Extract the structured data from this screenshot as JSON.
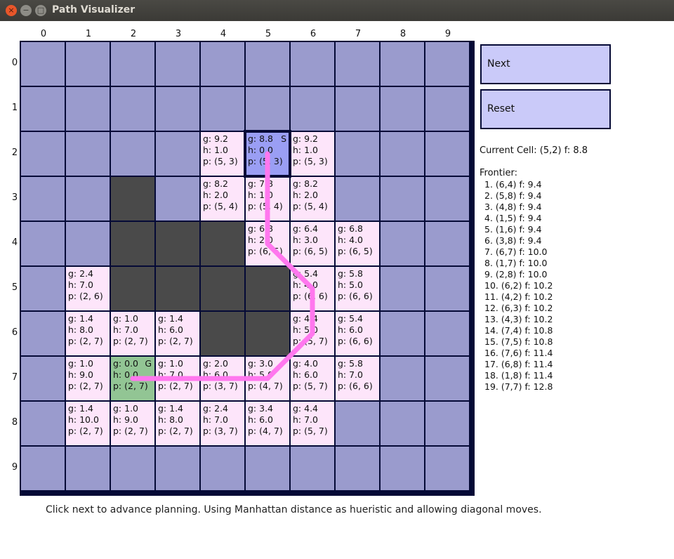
{
  "window": {
    "title": "Path Visualizer",
    "close": "×",
    "minimize": "−",
    "maximize": "□"
  },
  "columns": [
    "0",
    "1",
    "2",
    "3",
    "4",
    "5",
    "6",
    "7",
    "8",
    "9"
  ],
  "rows": [
    "0",
    "1",
    "2",
    "3",
    "4",
    "5",
    "6",
    "7",
    "8",
    "9"
  ],
  "cells": [
    {
      "r": 2,
      "c": 4,
      "type": "explored",
      "g": "g: 9.2",
      "h": "h: 1.0",
      "p": "p: (5, 3)"
    },
    {
      "r": 2,
      "c": 5,
      "type": "start",
      "g": "g: 8.8",
      "h": "h: 0.0",
      "p": "p: (5, 3)",
      "flag": "S"
    },
    {
      "r": 2,
      "c": 6,
      "type": "explored",
      "g": "g: 9.2",
      "h": "h: 1.0",
      "p": "p: (5, 3)"
    },
    {
      "r": 3,
      "c": 2,
      "type": "wall"
    },
    {
      "r": 3,
      "c": 4,
      "type": "explored",
      "g": "g: 8.2",
      "h": "h: 2.0",
      "p": "p: (5, 4)"
    },
    {
      "r": 3,
      "c": 5,
      "type": "explored",
      "g": "g: 7.8",
      "h": "h: 1.0",
      "p": "p: (5, 4)"
    },
    {
      "r": 3,
      "c": 6,
      "type": "explored",
      "g": "g: 8.2",
      "h": "h: 2.0",
      "p": "p: (5, 4)"
    },
    {
      "r": 4,
      "c": 2,
      "type": "wall"
    },
    {
      "r": 4,
      "c": 3,
      "type": "wall"
    },
    {
      "r": 4,
      "c": 4,
      "type": "wall"
    },
    {
      "r": 4,
      "c": 5,
      "type": "explored",
      "g": "g: 6.8",
      "h": "h: 2.0",
      "p": "p: (6, 5)"
    },
    {
      "r": 4,
      "c": 6,
      "type": "explored",
      "g": "g: 6.4",
      "h": "h: 3.0",
      "p": "p: (6, 5)"
    },
    {
      "r": 4,
      "c": 7,
      "type": "explored",
      "g": "g: 6.8",
      "h": "h: 4.0",
      "p": "p: (6, 5)"
    },
    {
      "r": 5,
      "c": 1,
      "type": "explored",
      "g": "g: 2.4",
      "h": "h: 7.0",
      "p": "p: (2, 6)"
    },
    {
      "r": 5,
      "c": 2,
      "type": "wall"
    },
    {
      "r": 5,
      "c": 3,
      "type": "wall"
    },
    {
      "r": 5,
      "c": 4,
      "type": "wall"
    },
    {
      "r": 5,
      "c": 5,
      "type": "wall"
    },
    {
      "r": 5,
      "c": 6,
      "type": "explored",
      "g": "g: 5.4",
      "h": "h: 4.0",
      "p": "p: (6, 6)"
    },
    {
      "r": 5,
      "c": 7,
      "type": "explored",
      "g": "g: 5.8",
      "h": "h: 5.0",
      "p": "p: (6, 6)"
    },
    {
      "r": 6,
      "c": 1,
      "type": "explored",
      "g": "g: 1.4",
      "h": "h: 8.0",
      "p": "p: (2, 7)"
    },
    {
      "r": 6,
      "c": 2,
      "type": "explored",
      "g": "g: 1.0",
      "h": "h: 7.0",
      "p": "p: (2, 7)"
    },
    {
      "r": 6,
      "c": 3,
      "type": "explored",
      "g": "g: 1.4",
      "h": "h: 6.0",
      "p": "p: (2, 7)"
    },
    {
      "r": 6,
      "c": 4,
      "type": "wall"
    },
    {
      "r": 6,
      "c": 5,
      "type": "wall"
    },
    {
      "r": 6,
      "c": 6,
      "type": "explored",
      "g": "g: 4.4",
      "h": "h: 5.0",
      "p": "p: (5, 7)"
    },
    {
      "r": 6,
      "c": 7,
      "type": "explored",
      "g": "g: 5.4",
      "h": "h: 6.0",
      "p": "p: (6, 6)"
    },
    {
      "r": 7,
      "c": 1,
      "type": "explored",
      "g": "g: 1.0",
      "h": "h: 9.0",
      "p": "p: (2, 7)"
    },
    {
      "r": 7,
      "c": 2,
      "type": "goal",
      "g": "g: 0.0",
      "h": "h: 0.0",
      "p": "p: (2, 7)",
      "flag": "G"
    },
    {
      "r": 7,
      "c": 3,
      "type": "explored",
      "g": "g: 1.0",
      "h": "h: 7.0",
      "p": "p: (2, 7)"
    },
    {
      "r": 7,
      "c": 4,
      "type": "explored",
      "g": "g: 2.0",
      "h": "h: 6.0",
      "p": "p: (3, 7)"
    },
    {
      "r": 7,
      "c": 5,
      "type": "explored",
      "g": "g: 3.0",
      "h": "h: 5.0",
      "p": "p: (4, 7)"
    },
    {
      "r": 7,
      "c": 6,
      "type": "explored",
      "g": "g: 4.0",
      "h": "h: 6.0",
      "p": "p: (5, 7)"
    },
    {
      "r": 7,
      "c": 7,
      "type": "explored",
      "g": "g: 5.8",
      "h": "h: 7.0",
      "p": "p: (6, 6)"
    },
    {
      "r": 8,
      "c": 1,
      "type": "explored",
      "g": "g: 1.4",
      "h": "h: 10.0",
      "p": "p: (2, 7)"
    },
    {
      "r": 8,
      "c": 2,
      "type": "explored",
      "g": "g: 1.0",
      "h": "h: 9.0",
      "p": "p: (2, 7)"
    },
    {
      "r": 8,
      "c": 3,
      "type": "explored",
      "g": "g: 1.4",
      "h": "h: 8.0",
      "p": "p: (2, 7)"
    },
    {
      "r": 8,
      "c": 4,
      "type": "explored",
      "g": "g: 2.4",
      "h": "h: 7.0",
      "p": "p: (3, 7)"
    },
    {
      "r": 8,
      "c": 5,
      "type": "explored",
      "g": "g: 3.4",
      "h": "h: 6.0",
      "p": "p: (4, 7)"
    },
    {
      "r": 8,
      "c": 6,
      "type": "explored",
      "g": "g: 4.4",
      "h": "h: 7.0",
      "p": "p: (5, 7)"
    }
  ],
  "path_cells": [
    [
      5,
      2
    ],
    [
      5,
      3
    ],
    [
      5,
      4
    ],
    [
      6,
      5
    ],
    [
      6,
      6
    ],
    [
      5,
      7
    ],
    [
      4,
      7
    ],
    [
      3,
      7
    ],
    [
      2,
      7
    ]
  ],
  "colors": {
    "path": "#ff77ee",
    "grid_line": "#050a36",
    "open": "#9a9bcd",
    "explored": "#fde5fa",
    "wall": "#4a4a4a",
    "goal": "#92c594",
    "start": "#9a9ef4",
    "button": "#cacaf9"
  },
  "controls": {
    "next_label": "Next",
    "reset_label": "Reset"
  },
  "current_cell": "Current Cell: (5,2) f: 8.8",
  "frontier": {
    "title": "Frontier:",
    "items": [
      "1. (6,4) f: 9.4",
      "2. (5,8) f: 9.4",
      "3. (4,8) f: 9.4",
      "4. (1,5) f: 9.4",
      "5. (1,6) f: 9.4",
      "6. (3,8) f: 9.4",
      "7. (6,7) f: 10.0",
      "8. (1,7) f: 10.0",
      "9. (2,8) f: 10.0",
      "10. (6,2) f: 10.2",
      "11. (4,2) f: 10.2",
      "12. (6,3) f: 10.2",
      "13. (4,3) f: 10.2",
      "14. (7,4) f: 10.8",
      "15. (7,5) f: 10.8",
      "16. (7,6) f: 11.4",
      "17. (6,8) f: 11.4",
      "18. (1,8) f: 11.4",
      "19. (7,7) f: 12.8"
    ]
  },
  "footer": "Click next to advance planning. Using Manhattan distance as hueristic and allowing diagonal moves."
}
